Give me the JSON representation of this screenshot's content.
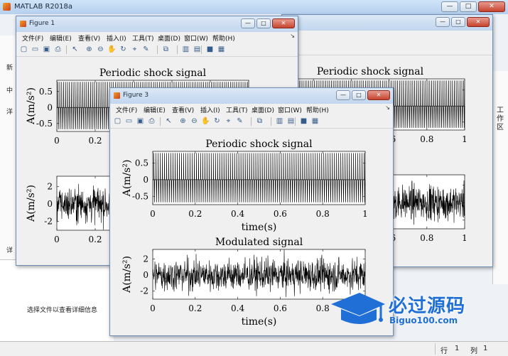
{
  "app": {
    "title": "MATLAB R2018a",
    "caption": {
      "minimize": "—",
      "maximize": "□",
      "close": "✕"
    }
  },
  "background": {
    "side_labels": [
      "新",
      "中",
      "洋",
      "详"
    ],
    "right_panel_label": "工作区",
    "detail_text": "选择文件以查看详细信息",
    "status": {
      "line_label": "行",
      "line_value": "1",
      "col_label": "列",
      "col_value": "1"
    }
  },
  "figure_menu": [
    "文件(F)",
    "编辑(E)",
    "查看(V)",
    "插入(I)",
    "工具(T)",
    "桌面(D)",
    "窗口(W)",
    "帮助(H)"
  ],
  "toolbar_icons": [
    "new-file-icon",
    "open-folder-icon",
    "save-icon",
    "print-icon",
    "pointer-icon",
    "zoom-in-icon",
    "zoom-out-icon",
    "pan-icon",
    "rotate-icon",
    "data-cursor-icon",
    "brush-icon",
    "link-icon",
    "colorbar-icon",
    "legend-icon",
    "hide-plot-tools-icon",
    "show-plot-tools-icon"
  ],
  "figures": [
    {
      "id": "figure1",
      "title": "Figure 1"
    },
    {
      "id": "figure2",
      "title": ""
    },
    {
      "id": "figure3",
      "title": "Figure 3"
    }
  ],
  "colors": {
    "accent": "#1f6fd6",
    "signal": "#000000"
  },
  "chart_data": [
    {
      "type": "line",
      "title": "Periodic shock signal",
      "xlabel": "time(s)",
      "ylabel": "A(m/s²)",
      "xlim": [
        0,
        1
      ],
      "ylim": [
        -0.75,
        0.85
      ],
      "xticks": [
        "0",
        "0.2",
        "0.4",
        "0.6",
        "0.8",
        "1"
      ],
      "yticks": [
        "-0.5",
        "0",
        "0.5"
      ],
      "pulse_count": 100,
      "amplitude": 0.8,
      "grid": false
    },
    {
      "type": "line",
      "title": "Modulated signal",
      "xlabel": "time(s)",
      "ylabel": "A(m/s²)",
      "xlim": [
        0,
        1
      ],
      "ylim": [
        -3,
        3.2
      ],
      "xticks": [
        "0",
        "0.2",
        "0.4",
        "0.6",
        "0.8",
        "1"
      ],
      "yticks": [
        "-2",
        "0",
        "2"
      ],
      "noise_std": 1.0,
      "grid": false
    }
  ],
  "watermark": {
    "cn": "必过源码",
    "en": "Biguo100.com"
  }
}
